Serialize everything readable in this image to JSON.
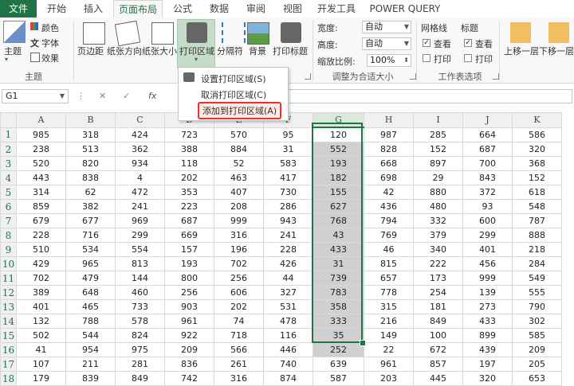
{
  "tabs": [
    "文件",
    "开始",
    "插入",
    "页面布局",
    "公式",
    "数据",
    "审阅",
    "视图",
    "开发工具",
    "POWER QUERY"
  ],
  "ribbon": {
    "theme": {
      "main": "主题",
      "colors": "颜色",
      "fonts": "字体",
      "effects": "效果",
      "group": "主题"
    },
    "page_setup": {
      "margins": "页边距",
      "orientation": "纸张方向",
      "size": "纸张大小",
      "print_area": "打印区域",
      "breaks": "分隔符",
      "background": "背景",
      "print_titles": "打印标题",
      "group": "页"
    },
    "scale": {
      "width_label": "宽度:",
      "width_value": "自动",
      "height_label": "高度:",
      "height_value": "自动",
      "scale_label": "缩放比例:",
      "scale_value": "100%",
      "group": "调整为合适大小"
    },
    "sheet_options": {
      "gridlines": "网格线",
      "headings": "标题",
      "view": "查看",
      "print": "打印",
      "group": "工作表选项"
    },
    "arrange": {
      "bring_forward": "上移一层",
      "send_backward": "下移一层"
    }
  },
  "menu": {
    "set_print_area": "设置打印区域(S)",
    "clear_print_area": "取消打印区域(C)",
    "add_to_print_area": "添加到打印区域(A)"
  },
  "formula_bar": {
    "name_box": "G1",
    "fx": "fx"
  },
  "sheet": {
    "columns": [
      "A",
      "B",
      "C",
      "D",
      "E",
      "F",
      "G",
      "H",
      "I",
      "J",
      "K"
    ],
    "rows": [
      [
        "985",
        "318",
        "424",
        "723",
        "570",
        "95",
        "120",
        "987",
        "285",
        "664",
        "586"
      ],
      [
        "238",
        "513",
        "362",
        "388",
        "884",
        "31",
        "552",
        "828",
        "152",
        "687",
        "320"
      ],
      [
        "520",
        "820",
        "934",
        "118",
        "52",
        "583",
        "193",
        "668",
        "897",
        "700",
        "368"
      ],
      [
        "443",
        "838",
        "4",
        "202",
        "463",
        "417",
        "182",
        "698",
        "29",
        "843",
        "152"
      ],
      [
        "314",
        "62",
        "472",
        "353",
        "407",
        "730",
        "155",
        "42",
        "880",
        "372",
        "618"
      ],
      [
        "859",
        "382",
        "241",
        "223",
        "208",
        "286",
        "627",
        "436",
        "480",
        "93",
        "548"
      ],
      [
        "679",
        "677",
        "969",
        "687",
        "999",
        "943",
        "768",
        "794",
        "332",
        "600",
        "787"
      ],
      [
        "228",
        "716",
        "299",
        "669",
        "316",
        "241",
        "43",
        "769",
        "379",
        "299",
        "888"
      ],
      [
        "510",
        "534",
        "554",
        "157",
        "196",
        "228",
        "433",
        "46",
        "340",
        "401",
        "218"
      ],
      [
        "429",
        "965",
        "813",
        "193",
        "702",
        "426",
        "31",
        "815",
        "222",
        "456",
        "284"
      ],
      [
        "702",
        "479",
        "144",
        "800",
        "256",
        "44",
        "739",
        "657",
        "173",
        "999",
        "549"
      ],
      [
        "389",
        "648",
        "460",
        "256",
        "606",
        "327",
        "783",
        "778",
        "254",
        "139",
        "555"
      ],
      [
        "401",
        "465",
        "733",
        "903",
        "202",
        "531",
        "358",
        "315",
        "181",
        "273",
        "790"
      ],
      [
        "132",
        "788",
        "578",
        "961",
        "74",
        "478",
        "333",
        "216",
        "849",
        "433",
        "302"
      ],
      [
        "502",
        "544",
        "824",
        "922",
        "718",
        "116",
        "35",
        "149",
        "100",
        "899",
        "585"
      ],
      [
        "41",
        "954",
        "975",
        "209",
        "566",
        "446",
        "252",
        "22",
        "672",
        "439",
        "209"
      ],
      [
        "107",
        "211",
        "281",
        "836",
        "261",
        "740",
        "639",
        "961",
        "857",
        "197",
        "205"
      ],
      [
        "179",
        "839",
        "849",
        "742",
        "316",
        "874",
        "587",
        "203",
        "445",
        "320",
        "653"
      ]
    ]
  }
}
